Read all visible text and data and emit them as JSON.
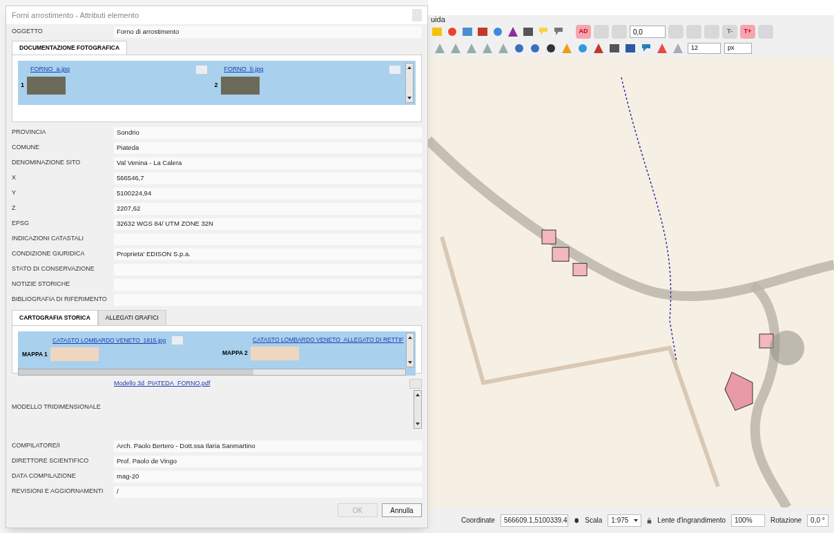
{
  "menu_bar": {
    "items": [
      "uida"
    ]
  },
  "toolbar_row_1": {
    "buttons": [
      {
        "label": "AD",
        "disabled": false
      },
      {
        "disabled": true
      },
      {
        "disabled": true
      }
    ],
    "field": "0,0",
    "buttons_after": [
      {
        "disabled": true
      },
      {
        "disabled": true
      },
      {
        "disabled": true
      },
      {
        "label": "T-",
        "disabled": true
      },
      {
        "label": "T+",
        "disabled": false
      },
      {
        "disabled": true
      }
    ]
  },
  "toolbar_row_2": {
    "field": "12",
    "unit": "px"
  },
  "status_bar": {
    "coordinate_label": "Coordinate",
    "coordinate": "566609.1,5100339.4",
    "scale_label": "Scala",
    "scale": "1:975",
    "magnifier_label": "Lente d'ingrandimento",
    "magnifier": "100%",
    "rotation_label": "Rotazione",
    "rotation": "0,0 °"
  },
  "dialog": {
    "title": "Forni arrostimento - Attributi elemento",
    "oggetto": {
      "label": "OGGETTO",
      "value": "Forno di arrostimento"
    },
    "photo_tabs": [
      {
        "label": "DOCUMENTAZIONE FOTOGRAFICA",
        "selected": true
      }
    ],
    "photos": [
      {
        "index": "1",
        "file": "FORNO_a.jpg"
      },
      {
        "index": "2",
        "file": "FORNO_b.jpg"
      }
    ],
    "fields": [
      {
        "label": "PROVINCIA",
        "value": "Sondrio"
      },
      {
        "label": "COMUNE",
        "value": "Piateda"
      },
      {
        "label": "DENOMINAZIONE SITO",
        "value": "Val Venina - La Calera"
      },
      {
        "label": "X",
        "value": "566546,7"
      },
      {
        "label": "Y",
        "value": "5100224,94"
      },
      {
        "label": "Z",
        "value": "2207,62"
      },
      {
        "label": "EPSG",
        "value": "32632 WGS 84/ UTM ZONE 32N"
      },
      {
        "label": "INDICAZIONI CATASTALI"
      },
      {
        "label": "CONDIZIONE GIURIDICA",
        "value": "Proprieta' EDISON S.p.a."
      },
      {
        "label": "STATO DI CONSERVAZIONE"
      },
      {
        "label": "NOTIZIE STORICHE"
      },
      {
        "label": "BIBLIOGRAFIA DI RIFERIMENTO"
      }
    ],
    "map_tabs": [
      {
        "label": "CARTOGRAFIA STORICA",
        "selected": true
      },
      {
        "label": "ALLEGATI GRAFICI",
        "selected": false
      }
    ],
    "maps": [
      {
        "index": "MAPPA 1",
        "file": "CATASTO LOMBARDO VENETO_1815.jpg"
      },
      {
        "index": "MAPPA 2",
        "file": "CATASTO LOMBARDO VENETO_ALLEGATO DI RETTIF"
      }
    ],
    "model": {
      "label": "MODELLO TRIDIMENSIONALE",
      "file": "Modello 3d_PIATEDA_FORNO.pdf"
    },
    "fields_2": [
      {
        "label": "COMPILATORE/I",
        "value": "Arch. Paolo Bertero - Dott.ssa Ilaria Sanmartino"
      },
      {
        "label": "DIRETTORE SCIENTIFICO",
        "value": "Prof. Paolo de Vingo"
      },
      {
        "label": "DATA COMPILAZIONE",
        "value": "mag-20"
      },
      {
        "label": "REVISIONI E AGGIORNAMENTI",
        "value": "/"
      }
    ],
    "buttons": [
      {
        "label": "OK",
        "disabled": true
      },
      {
        "label": "Annulla",
        "disabled": false
      }
    ]
  }
}
